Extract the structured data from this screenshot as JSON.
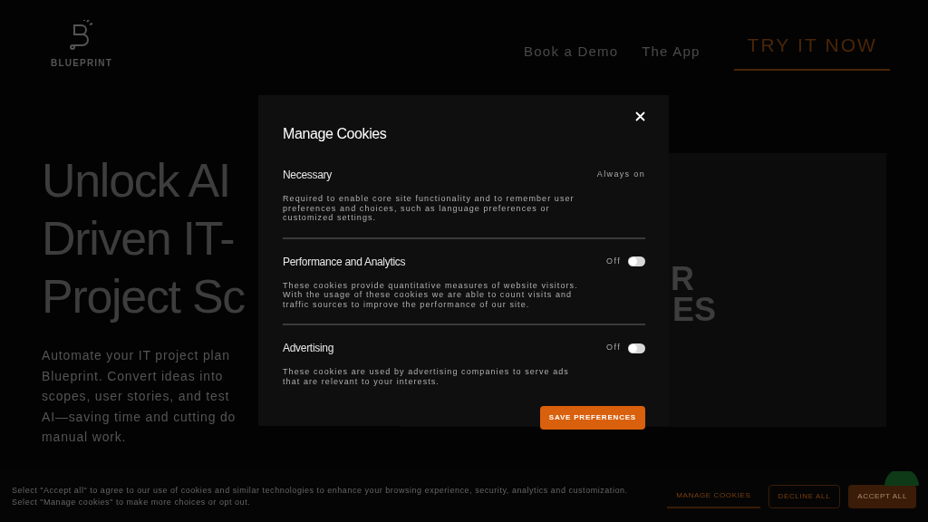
{
  "header": {
    "logo": "BLUEPRINT",
    "nav": [
      "Book a Demo",
      "The App"
    ],
    "cta": "TRY IT NOW"
  },
  "hero": {
    "title_lines": [
      "Unlock AI",
      "Driven IT-",
      "Project Sc"
    ],
    "text_lines": [
      "Automate your IT project plan",
      "Blueprint. Convert ideas into",
      "scopes, user stories, and test",
      "AI—saving time and cutting do",
      "manual work."
    ],
    "card_lines": [
      "R",
      "ES"
    ]
  },
  "modal": {
    "title": "Manage Cookies",
    "save": "SAVE PREFERENCES",
    "sections": [
      {
        "kind": "fixed",
        "name": "Necessary",
        "status": "Always on",
        "description": "Required to enable core site functionality and to remember user preferences and choices, such as language preferences or customized settings."
      },
      {
        "kind": "toggle",
        "name": "Performance and Analytics",
        "status": "Off",
        "on": false,
        "description": "These cookies provide quantitative measures of website visitors. With the usage of these cookies we are able to count visits and traffic sources to improve the performance of our site."
      },
      {
        "kind": "toggle",
        "name": "Advertising",
        "status": "Off",
        "on": false,
        "description": "These cookies are used by advertising companies to serve ads that are relevant to your interests."
      }
    ]
  },
  "cookie_bar": {
    "lines": [
      "Select \"Accept all\" to agree to our use of cookies and similar technologies to enhance your browsing experience, security, analytics and customization.",
      "Select \"Manage cookies\" to make more choices or opt out."
    ],
    "manage": "MANAGE COOKIES",
    "decline": "DECLINE ALL",
    "accept": "ACCEPT ALL"
  }
}
